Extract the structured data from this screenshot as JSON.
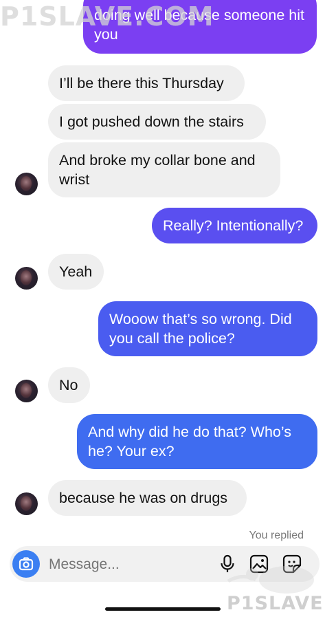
{
  "watermark": {
    "text": "P1SLAVE.COM",
    "bottom_text": "P1SLAVE"
  },
  "colors": {
    "incoming_bubble": "#efefef",
    "outgoing_top": "#7b3ff2",
    "outgoing_mid": "#5a4ff0",
    "outgoing_bottom": "#3f6cf0",
    "camera_button": "#3b7ff2"
  },
  "messages": [
    {
      "direction": "outgoing",
      "text": "doing well because someone hit you"
    },
    {
      "direction": "incoming",
      "text": "I’ll be there this Thursday"
    },
    {
      "direction": "incoming",
      "text": "I got pushed down the stairs"
    },
    {
      "direction": "incoming",
      "text": "And broke my collar bone and wrist"
    },
    {
      "direction": "outgoing",
      "text": "Really? Intentionally?"
    },
    {
      "direction": "incoming",
      "text": "Yeah"
    },
    {
      "direction": "outgoing",
      "text": "Wooow that’s so wrong. Did you call the police?"
    },
    {
      "direction": "incoming",
      "text": "No"
    },
    {
      "direction": "outgoing",
      "text": "And why did he do that? Who’s he? Your ex?"
    },
    {
      "direction": "incoming",
      "text": "because he was on drugs"
    }
  ],
  "status": {
    "replied": "You replied"
  },
  "composer": {
    "placeholder": "Message...",
    "icons": [
      "camera-icon",
      "microphone-icon",
      "gallery-icon",
      "sticker-icon"
    ]
  }
}
